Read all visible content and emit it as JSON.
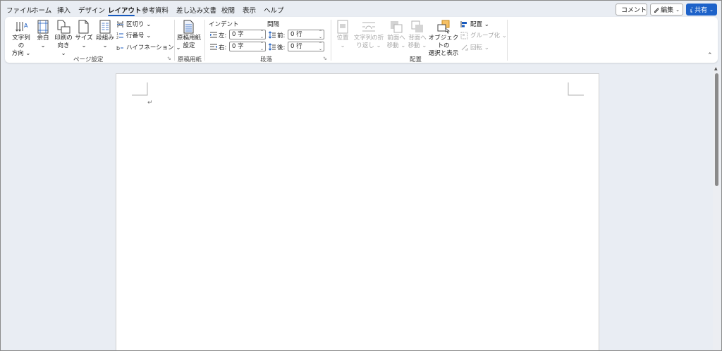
{
  "tabs": [
    "ファイル",
    "ホーム",
    "挿入",
    "デザイン",
    "レイアウト",
    "参考資料",
    "差し込み文書",
    "校閲",
    "表示",
    "ヘルプ"
  ],
  "top_right": {
    "comment": "コメント",
    "edit": "編集",
    "share": "共有"
  },
  "page_setup": {
    "text_direction": [
      "文字列の",
      "方向 ⌄"
    ],
    "margins": [
      "余白",
      "⌄"
    ],
    "orientation": [
      "印刷の",
      "向き ⌄"
    ],
    "size": [
      "サイズ",
      "⌄"
    ],
    "columns": [
      "段組み",
      "⌄"
    ],
    "breaks": "区切り ⌄",
    "line_numbers": "行番号 ⌄",
    "hyphenation": "ハイフネーション ⌄",
    "group": "ページ設定"
  },
  "manuscript": {
    "button": [
      "原稿用紙",
      "設定"
    ],
    "group": "原稿用紙"
  },
  "paragraph": {
    "indent_title": "インデント",
    "spacing_title": "間隔",
    "left_label": "左:",
    "right_label": "右:",
    "before_label": "前:",
    "after_label": "後:",
    "left_value": "0 字",
    "right_value": "0 字",
    "before_value": "0 行",
    "after_value": "0 行",
    "group": "段落"
  },
  "arrange": {
    "position": [
      "位置",
      "⌄"
    ],
    "wrap_text": [
      "文字列の折",
      "り返し ⌄"
    ],
    "bring_forward": [
      "前面へ",
      "移動 ⌄"
    ],
    "send_backward": [
      "背面へ",
      "移動 ⌄"
    ],
    "selection_pane": [
      "オブジェクトの",
      "選択と表示"
    ],
    "align": "配置 ⌄",
    "group_obj": "グループ化 ⌄",
    "rotate": "回転 ⌄",
    "group": "配置"
  },
  "document": {
    "paragraph_mark": "↵"
  },
  "colors": {
    "accent": "#185abd",
    "share_bg": "#1d62c9"
  }
}
